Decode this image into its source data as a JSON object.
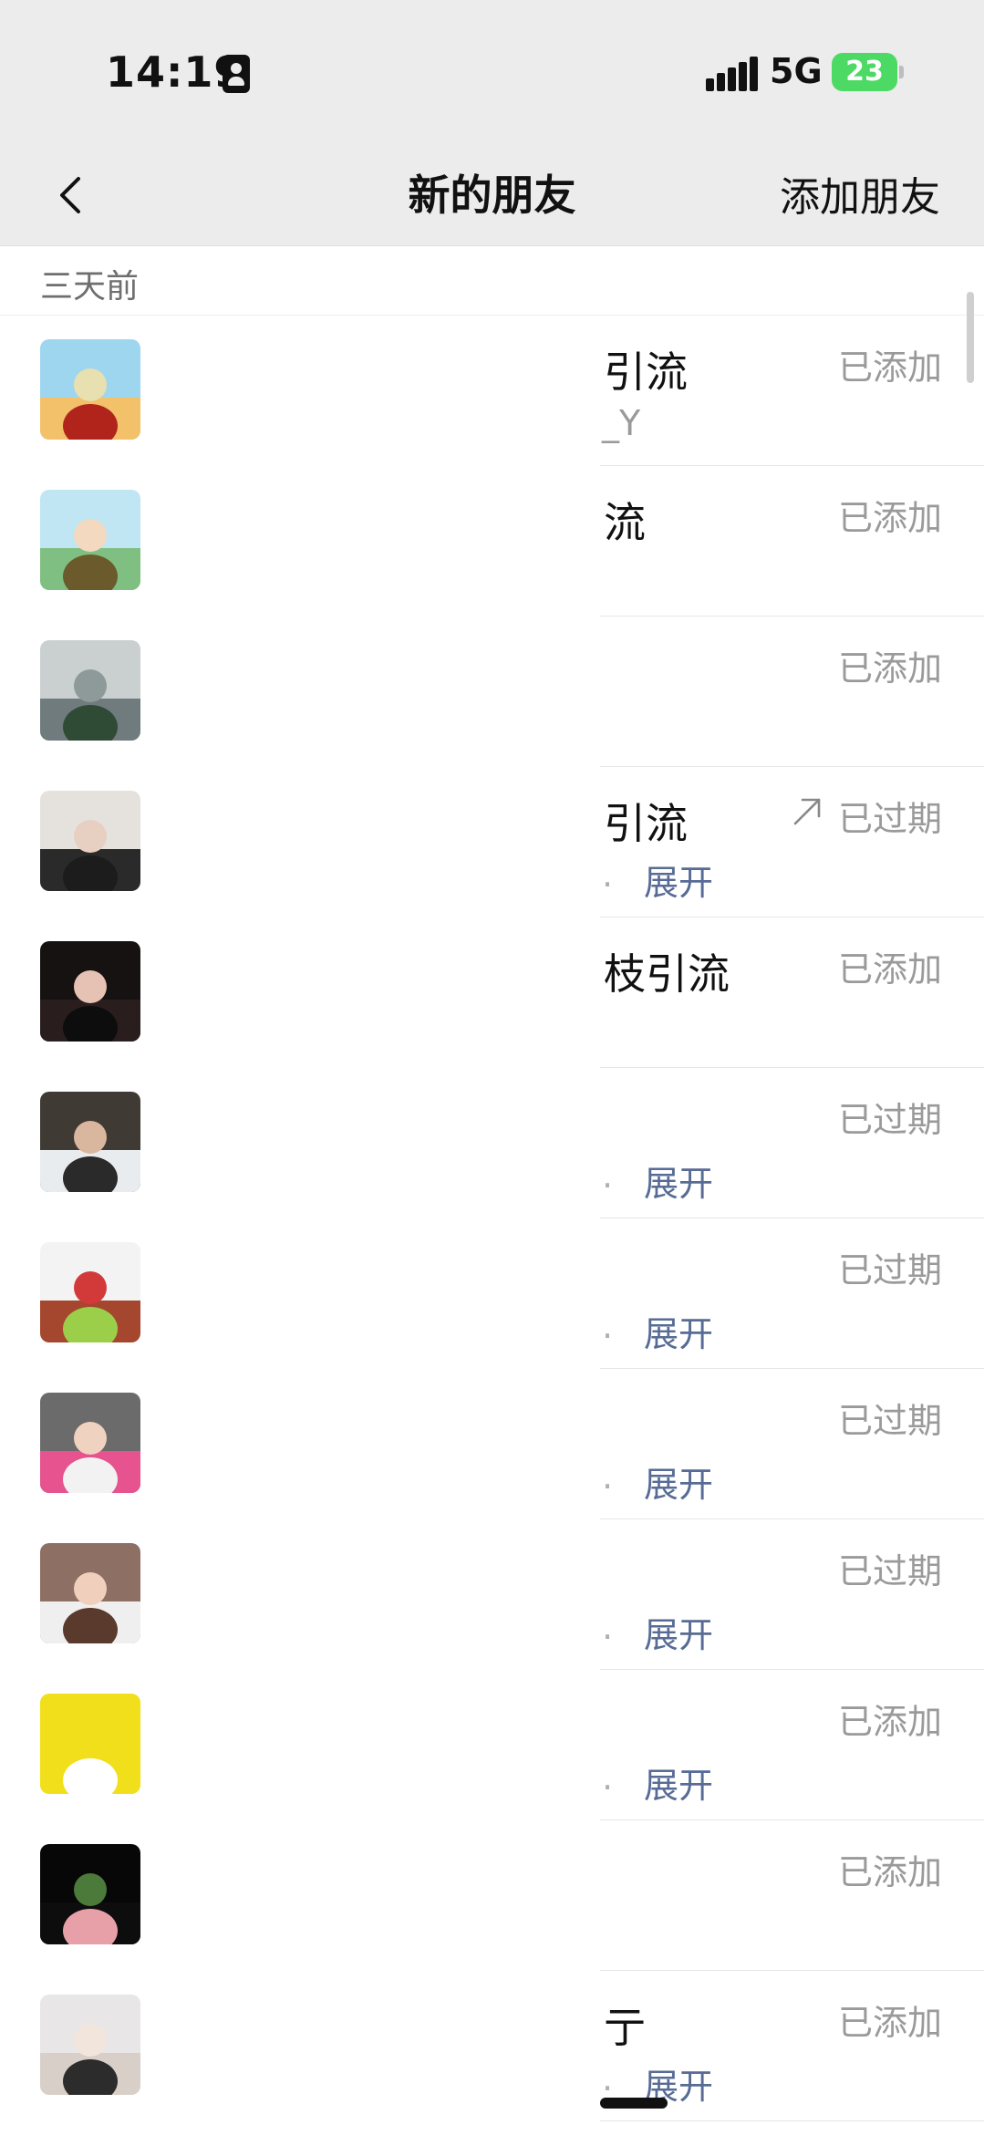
{
  "status_bar": {
    "time": "14:19",
    "network": "5G",
    "battery": "23"
  },
  "nav": {
    "title": "新的朋友",
    "action": "添加朋友",
    "back_icon": "chevron-left-icon"
  },
  "section": {
    "label": "三天前"
  },
  "rows": [
    {
      "name": "引流",
      "sub": "_Y",
      "expand": "",
      "status": "已添加",
      "share": false,
      "avatar": {
        "top": "#9ed6ef",
        "bottom": "#f2c16a",
        "figure": "#b1241c",
        "accent": "#e8e0b0"
      }
    },
    {
      "name": "流",
      "sub": "",
      "expand": "",
      "status": "已添加",
      "share": false,
      "avatar": {
        "top": "#bfe6f2",
        "bottom": "#7fbf82",
        "figure": "#6b5a2b",
        "accent": "#f3d9c0"
      }
    },
    {
      "name": "",
      "sub": "",
      "expand": "",
      "status": "已添加",
      "share": false,
      "avatar": {
        "top": "#c9d0cf",
        "bottom": "#6f7b7d",
        "figure": "#2f4a35",
        "accent": "#8e9a9a"
      }
    },
    {
      "name": "引流",
      "sub": "",
      "expand": "展开",
      "status": "已过期",
      "share": true,
      "avatar": {
        "top": "#e5e2dd",
        "bottom": "#2a2a2a",
        "figure": "#1c1c1c",
        "accent": "#e7cfc2"
      }
    },
    {
      "name": "枝引流",
      "sub": "",
      "expand": "",
      "status": "已添加",
      "share": false,
      "avatar": {
        "top": "#161212",
        "bottom": "#2a1d1d",
        "figure": "#0d0d0d",
        "accent": "#e6c2b4"
      }
    },
    {
      "name": "",
      "sub": "",
      "expand": "展开",
      "status": "已过期",
      "share": false,
      "avatar": {
        "top": "#3f3a33",
        "bottom": "#e9ecef",
        "figure": "#2a2a2a",
        "accent": "#d9b79f"
      }
    },
    {
      "name": "",
      "sub": "",
      "expand": "展开",
      "status": "已过期",
      "share": false,
      "avatar": {
        "top": "#f3f3f3",
        "bottom": "#a5462e",
        "figure": "#9bcf4a",
        "accent": "#d23a3a"
      }
    },
    {
      "name": "",
      "sub": "",
      "expand": "展开",
      "status": "已过期",
      "share": false,
      "avatar": {
        "top": "#6b6b6b",
        "bottom": "#e6538f",
        "figure": "#f2f2f2",
        "accent": "#f0d2c0"
      }
    },
    {
      "name": "",
      "sub": "",
      "expand": "展开",
      "status": "已过期",
      "share": false,
      "avatar": {
        "top": "#8e6f63",
        "bottom": "#efefef",
        "figure": "#5a3a2c",
        "accent": "#f0d0bd"
      }
    },
    {
      "name": "",
      "sub": "",
      "expand": "展开",
      "status": "已添加",
      "share": false,
      "avatar": {
        "top": "#f2df1c",
        "bottom": "#f2df1c",
        "figure": "#ffffff",
        "accent": "#f2df1c"
      }
    },
    {
      "name": "",
      "sub": "",
      "expand": "",
      "status": "已添加",
      "share": false,
      "avatar": {
        "top": "#070707",
        "bottom": "#0d0d0d",
        "figure": "#e8a0a8",
        "accent": "#4c7a3a"
      }
    },
    {
      "name": "亍",
      "sub": "",
      "expand": "展开",
      "status": "已添加",
      "share": false,
      "avatar": {
        "top": "#e8e6e6",
        "bottom": "#d9cfc9",
        "figure": "#2c2c2c",
        "accent": "#f2e6dc"
      }
    }
  ]
}
